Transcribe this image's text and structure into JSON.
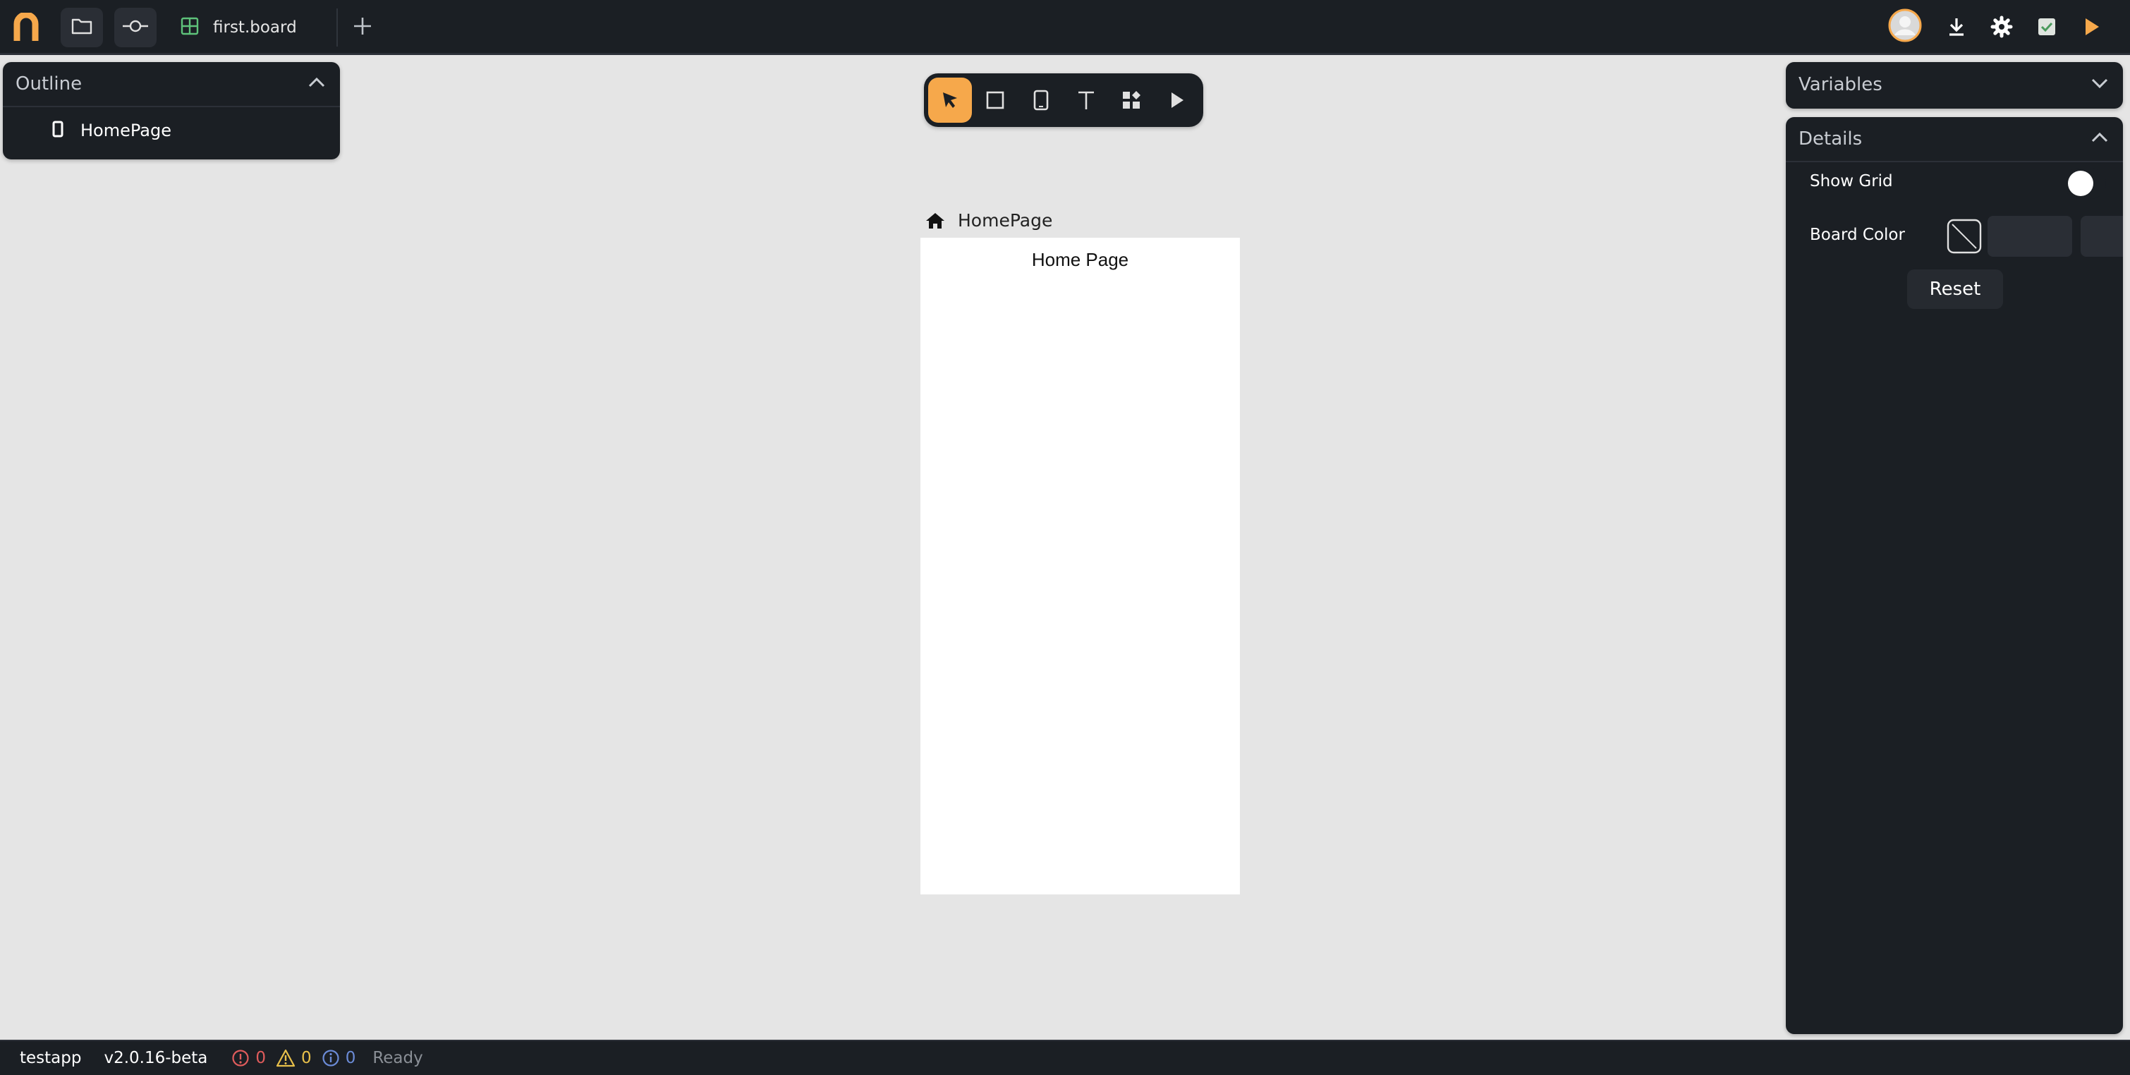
{
  "header": {
    "tab_label": "first.board",
    "icons": [
      "app-logo-icon",
      "folder-icon",
      "commit-icon",
      "grid-icon",
      "plus-icon",
      "avatar-icon",
      "download-icon",
      "gear-icon",
      "checklist-icon",
      "play-icon"
    ]
  },
  "outline": {
    "title": "Outline",
    "items": [
      {
        "label": "HomePage",
        "icon": "phone-icon"
      }
    ]
  },
  "toolbar": {
    "tools": [
      "select",
      "rectangle",
      "device",
      "text",
      "components",
      "play"
    ]
  },
  "canvas": {
    "board_label": "HomePage",
    "board_title": "Home Page"
  },
  "variables": {
    "title": "Variables"
  },
  "details": {
    "title": "Details",
    "show_grid_label": "Show Grid",
    "show_grid_on": false,
    "board_color_label": "Board Color",
    "reset_label": "Reset"
  },
  "status": {
    "project": "testapp",
    "version": "v2.0.16-beta",
    "errors": "0",
    "warnings": "0",
    "infos": "0",
    "state": "Ready"
  },
  "colors": {
    "accent": "#f6a84b",
    "panel": "#1b1f24",
    "canvas": "#e5e5e5",
    "error": "#e05c5c",
    "warning": "#e8c04a",
    "info": "#6b8bd6"
  }
}
